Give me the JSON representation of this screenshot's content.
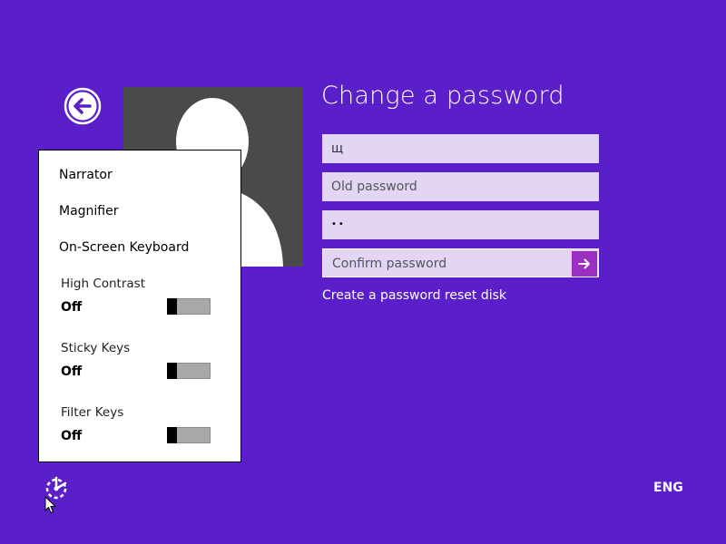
{
  "header": {
    "title": "Change a password"
  },
  "fields": {
    "current_value": "щ",
    "old_password_placeholder": "Old password",
    "new_password_value": "••",
    "confirm_placeholder": "Confirm password"
  },
  "links": {
    "reset_disk": "Create a password reset disk"
  },
  "ease_menu": {
    "items": [
      {
        "label": "Narrator"
      },
      {
        "label": "Magnifier"
      },
      {
        "label": "On-Screen Keyboard"
      }
    ],
    "toggles": [
      {
        "label": "High Contrast",
        "state": "Off"
      },
      {
        "label": "Sticky Keys",
        "state": "Off"
      },
      {
        "label": "Filter Keys",
        "state": "Off"
      }
    ]
  },
  "status_bar": {
    "language": "ENG"
  },
  "icons": {
    "back": "back-arrow-icon",
    "submit": "arrow-right-icon",
    "ease": "ease-of-access-icon",
    "cursor": "mouse-pointer-icon"
  },
  "colors": {
    "background": "#5a1fc8",
    "field": "#e3d6f5",
    "submit": "#9b2fc4",
    "avatar": "#4a4a4a"
  }
}
